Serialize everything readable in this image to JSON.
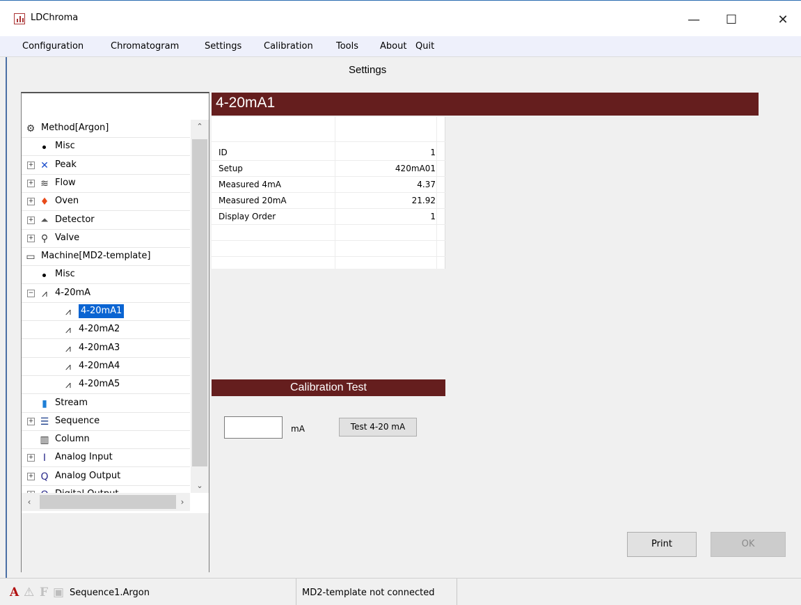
{
  "window": {
    "title": "LDChroma",
    "min_glyph": "—",
    "max_glyph": "☐",
    "close_glyph": "✕"
  },
  "menu": [
    "Configuration",
    "Chromatogram",
    "Settings",
    "Calibration",
    "Tools",
    "About",
    "Quit"
  ],
  "header": {
    "title": "Settings"
  },
  "tree": {
    "items": [
      {
        "label": "Method[Argon]",
        "icon": "gears-icon",
        "glyph": "⚙",
        "color": "#333333",
        "expander": "",
        "level": 0
      },
      {
        "label": "Misc",
        "icon": "bullet-icon",
        "glyph": "",
        "color": "#000000",
        "expander": "",
        "level": 1
      },
      {
        "label": "Peak",
        "icon": "peak-icon",
        "glyph": "✕",
        "color": "#1a4dcc",
        "expander": "+",
        "level": 1
      },
      {
        "label": "Flow",
        "icon": "flow-icon",
        "glyph": "≋",
        "color": "#333333",
        "expander": "+",
        "level": 1
      },
      {
        "label": "Oven",
        "icon": "flame-icon",
        "glyph": "♦",
        "color": "#e84a1a",
        "expander": "+",
        "level": 1
      },
      {
        "label": "Detector",
        "icon": "detector-icon",
        "glyph": "⏶",
        "color": "#555555",
        "expander": "+",
        "level": 1
      },
      {
        "label": "Valve",
        "icon": "valve-icon",
        "glyph": "⚲",
        "color": "#333333",
        "expander": "+",
        "level": 1
      },
      {
        "label": "Machine[MD2-template]",
        "icon": "machine-icon",
        "glyph": "▭",
        "color": "#333333",
        "expander": "",
        "level": 0
      },
      {
        "label": "Misc",
        "icon": "bullet-icon",
        "glyph": "",
        "color": "#000000",
        "expander": "",
        "level": 1
      },
      {
        "label": "4-20mA",
        "icon": "resistor-icon",
        "glyph": "⩘",
        "color": "#333333",
        "expander": "−",
        "level": 1
      },
      {
        "label": "4-20mA1",
        "icon": "resistor-icon",
        "glyph": "⩘",
        "color": "#333333",
        "expander": "",
        "level": 2,
        "selected": true
      },
      {
        "label": "4-20mA2",
        "icon": "resistor-icon",
        "glyph": "⩘",
        "color": "#333333",
        "expander": "",
        "level": 2
      },
      {
        "label": "4-20mA3",
        "icon": "resistor-icon",
        "glyph": "⩘",
        "color": "#333333",
        "expander": "",
        "level": 2
      },
      {
        "label": "4-20mA4",
        "icon": "resistor-icon",
        "glyph": "⩘",
        "color": "#333333",
        "expander": "",
        "level": 2
      },
      {
        "label": "4-20mA5",
        "icon": "resistor-icon",
        "glyph": "⩘",
        "color": "#333333",
        "expander": "",
        "level": 2
      },
      {
        "label": "Stream",
        "icon": "bottle-icon",
        "glyph": "▮",
        "color": "#1e7fd6",
        "expander": "",
        "level": 1
      },
      {
        "label": "Sequence",
        "icon": "list-icon",
        "glyph": "☰",
        "color": "#1a3d8a",
        "expander": "+",
        "level": 1
      },
      {
        "label": "Column",
        "icon": "column-icon",
        "glyph": "▥",
        "color": "#333333",
        "expander": "",
        "level": 1
      },
      {
        "label": "Analog Input",
        "icon": "analog-input-icon",
        "glyph": "Ⅰ",
        "color": "#2a2a8a",
        "expander": "+",
        "level": 1
      },
      {
        "label": "Analog Output",
        "icon": "analog-output-icon",
        "glyph": "Q",
        "color": "#2a2a8a",
        "expander": "+",
        "level": 1
      },
      {
        "label": "Digital Output",
        "icon": "digital-output-icon",
        "glyph": "O",
        "color": "#2a2a8a",
        "expander": "+",
        "level": 1
      }
    ]
  },
  "panel": {
    "title": "4-20mA1",
    "properties": [
      {
        "key": "ID",
        "value": "1"
      },
      {
        "key": "Setup",
        "value": "420mA01"
      },
      {
        "key": "Measured 4mA",
        "value": "4.37"
      },
      {
        "key": "Measured 20mA",
        "value": "21.92"
      },
      {
        "key": "Display Order",
        "value": "1"
      }
    ]
  },
  "calibration": {
    "title": "Calibration Test",
    "input_value": "",
    "unit": "mA",
    "button": "Test 4-20 mA"
  },
  "buttons": {
    "print": "Print",
    "ok": "OK"
  },
  "status": {
    "icon_a": "A",
    "icon_warn": "⚠",
    "icon_f": "F",
    "icon_save": "▣",
    "sequence": "Sequence1.Argon",
    "connection": "MD2-template not connected"
  },
  "colors": {
    "accent_dark_red": "#651e1e",
    "selection_blue": "#0a64d2"
  }
}
